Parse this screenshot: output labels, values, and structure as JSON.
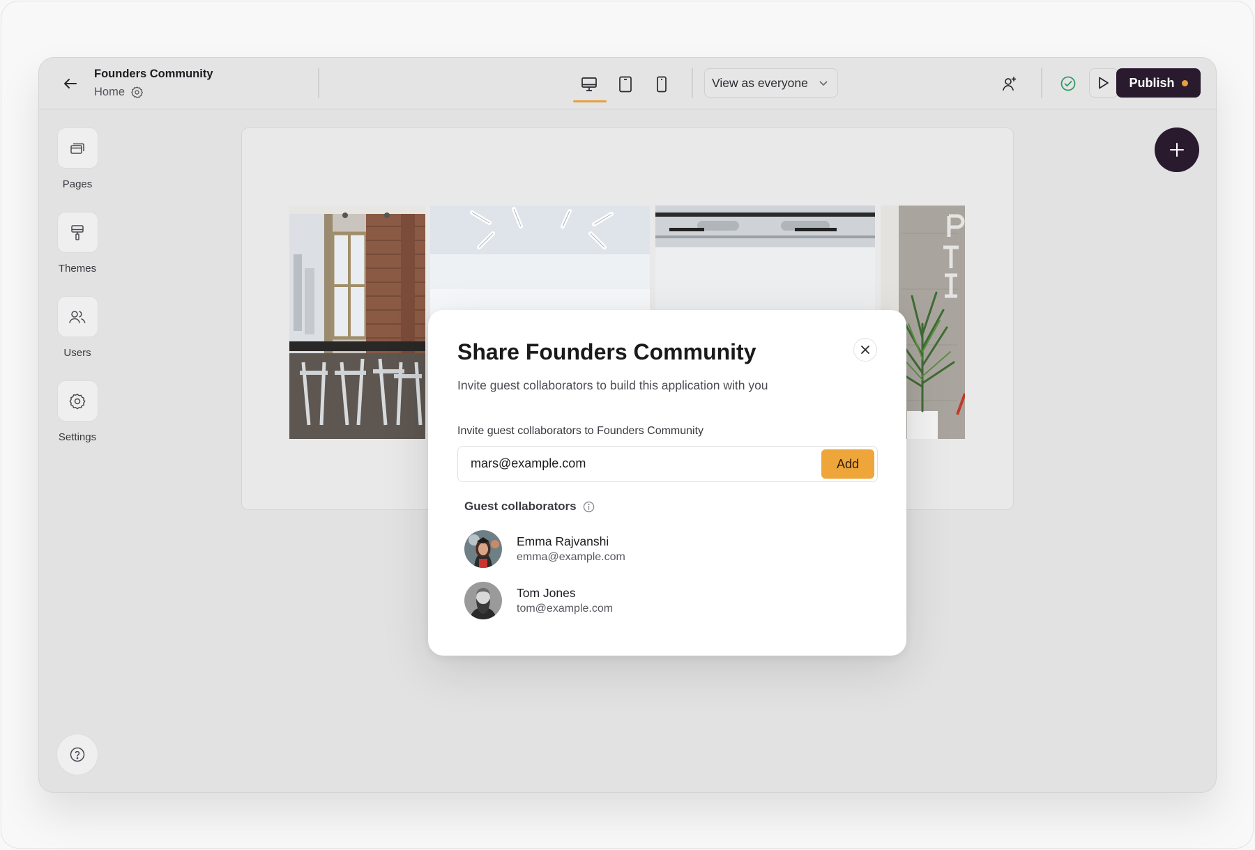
{
  "header": {
    "app_title": "Founders Community",
    "page_name": "Home",
    "view_select": "View as everyone",
    "publish_label": "Publish"
  },
  "sidebar": {
    "items": [
      {
        "label": "Pages",
        "icon": "pages-icon"
      },
      {
        "label": "Themes",
        "icon": "paint-roller-icon"
      },
      {
        "label": "Users",
        "icon": "users-icon"
      },
      {
        "label": "Settings",
        "icon": "gear-icon"
      }
    ]
  },
  "modal": {
    "title": "Share Founders Community",
    "subtitle": "Invite guest collaborators to build this application with you",
    "invite_label": "Invite guest collaborators to Founders Community",
    "invite_value": "mars@example.com",
    "add_label": "Add",
    "guests_heading": "Guest collaborators",
    "guests": [
      {
        "name": "Emma Rajvanshi",
        "email": "emma@example.com"
      },
      {
        "name": "Tom Jones",
        "email": "tom@example.com"
      }
    ]
  },
  "colors": {
    "accent": "#e8a03c",
    "primary_dark": "#2a1a2e",
    "success": "#2e9a6a"
  }
}
